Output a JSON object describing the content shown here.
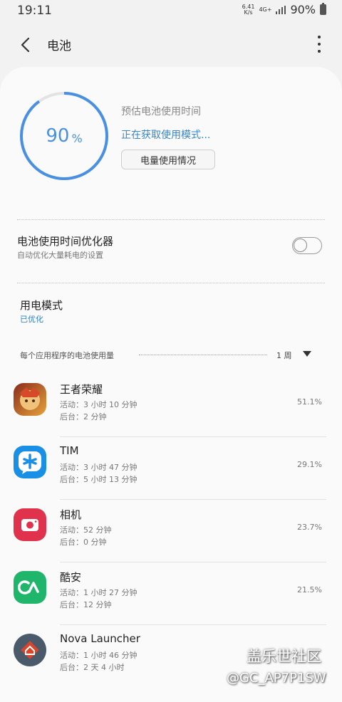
{
  "status_bar": {
    "time": "19:11",
    "net_speed_top": "6.41",
    "net_speed_bottom": "K/s",
    "net_type": "4G+",
    "battery_text": "90%"
  },
  "app_bar": {
    "title": "电池",
    "back_icon": "back-arrow-icon",
    "more_icon": "more-vert-icon"
  },
  "battery": {
    "percent": "90",
    "percent_sign": "%",
    "level_fraction": 0.9,
    "estimate_label": "预估电池使用时间",
    "estimate_status": "正在获取使用模式...",
    "usage_button_label": "电量使用情况",
    "ring_color": "#4a90e2"
  },
  "optimizer": {
    "title": "电池使用时间优化器",
    "subtitle": "自动优化大量耗电的设置",
    "enabled": false
  },
  "power_mode": {
    "title": "用电模式",
    "value": "已优化"
  },
  "app_usage": {
    "label": "每个应用程序的电池使用量",
    "period": "1 周",
    "apps": [
      {
        "name": "王者荣耀",
        "active": "活动：3 小时 10 分钟",
        "background": "后台：2 分钟",
        "percent": "51.1%",
        "icon": "game-icon"
      },
      {
        "name": "TIM",
        "active": "活动：3 小时 47 分钟",
        "background": "后台：5 小时 13 分钟",
        "percent": "29.1%",
        "icon": "tim-icon"
      },
      {
        "name": "相机",
        "active": "活动：52 分钟",
        "background": "后台：0 分钟",
        "percent": "23.7%",
        "icon": "camera-icon"
      },
      {
        "name": "酷安",
        "active": "活动：1 小时 27 分钟",
        "background": "后台：12 分钟",
        "percent": "21.5%",
        "icon": "coolapk-icon"
      },
      {
        "name": "Nova Launcher",
        "active": "活动：1 小时 46 分钟",
        "background": "后台：2 天 4 小时",
        "percent": "",
        "icon": "nova-launcher-icon"
      }
    ]
  },
  "watermark": {
    "line1": "盖乐世社区",
    "line2": "@GC_AP7P1SW"
  }
}
